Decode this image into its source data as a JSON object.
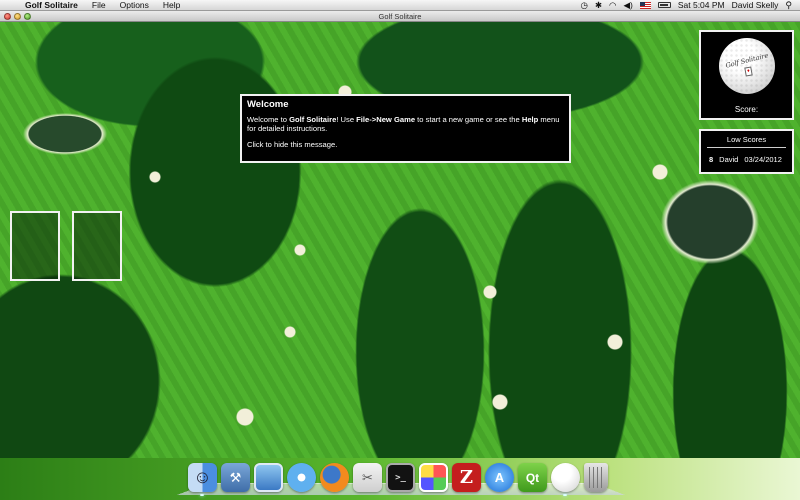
{
  "menubar": {
    "apple": "",
    "app_name": "Golf Solitaire",
    "items": [
      "File",
      "Options",
      "Help"
    ],
    "clock": "Sat 5:04 PM",
    "user": "David Skelly"
  },
  "window": {
    "title": "Golf Solitaire"
  },
  "welcome": {
    "heading": "Welcome",
    "text_1": "Welcome to ",
    "game_name": "Golf Solitaire",
    "text_2": "! Use ",
    "menu_path": "File->New Game",
    "text_3": " to start a new game or see the ",
    "help_menu": "Help",
    "text_4": " menu for detailed instructions.",
    "hide_hint": "Click to hide this message."
  },
  "score": {
    "label": "Score",
    "ball_text": "Golf Solitaire"
  },
  "low_scores": {
    "title": "Low Scores",
    "entries": [
      {
        "score": "8",
        "name": "David",
        "date": "03/24/2012"
      }
    ]
  },
  "dock": {
    "items": [
      {
        "name": "Finder",
        "icon": "finder-icon",
        "glyph": ""
      },
      {
        "name": "Xcode",
        "icon": "xcode-icon",
        "glyph": "⚒"
      },
      {
        "name": "Preview",
        "icon": "preview-icon",
        "glyph": ""
      },
      {
        "name": "Safari",
        "icon": "safari-icon",
        "glyph": ""
      },
      {
        "name": "Firefox",
        "icon": "firefox-icon",
        "glyph": ""
      },
      {
        "name": "Grapher",
        "icon": "grapher-icon",
        "glyph": "✂"
      },
      {
        "name": "Terminal",
        "icon": "terminal-icon",
        "glyph": ">_"
      },
      {
        "name": "Photo Booth",
        "icon": "photo-icon",
        "glyph": ""
      },
      {
        "name": "FileZilla",
        "icon": "filezilla-icon",
        "glyph": "Z"
      },
      {
        "name": "App Store",
        "icon": "appstore-icon",
        "glyph": "A"
      },
      {
        "name": "Qt Creator",
        "icon": "qt-icon",
        "glyph": "Qt"
      },
      {
        "name": "Golf Solitaire",
        "icon": "golf-ball-icon",
        "glyph": ""
      },
      {
        "name": "Trash",
        "icon": "trash-icon",
        "glyph": ""
      }
    ]
  },
  "colors": {
    "panel_bg": "#000000",
    "panel_border": "#f2f2f2",
    "fairway": "#46a428",
    "trees": "#0f4a12"
  }
}
